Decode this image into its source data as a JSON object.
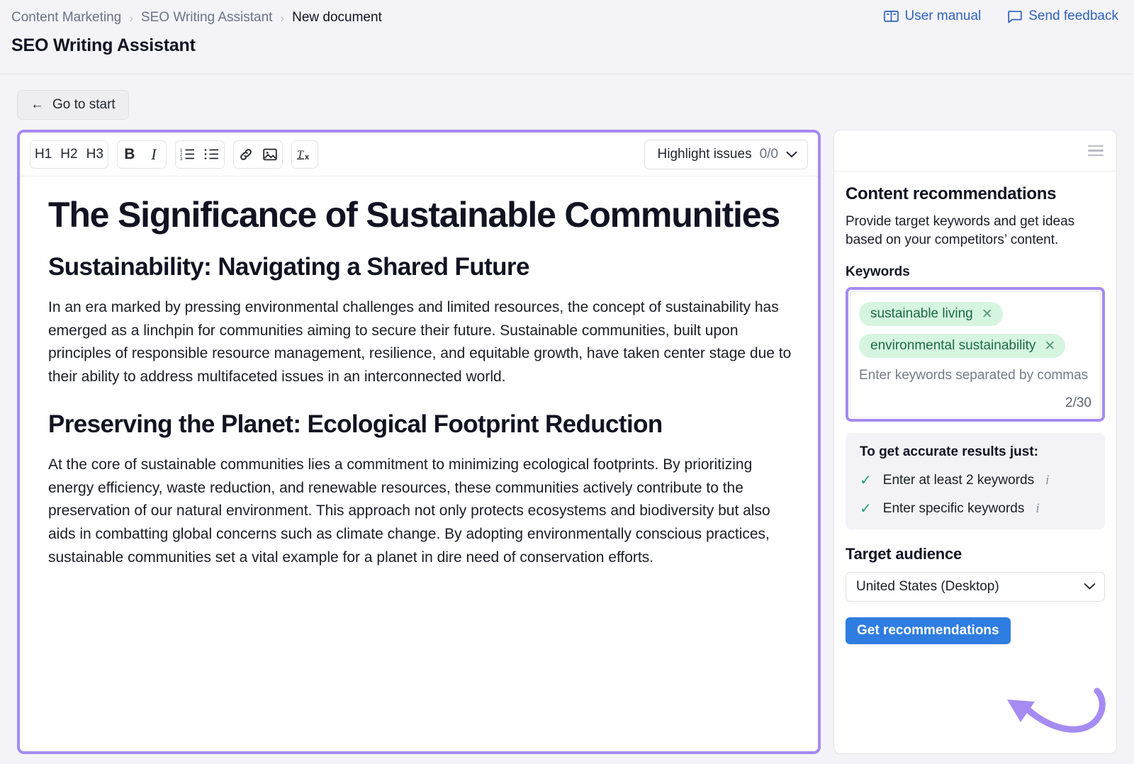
{
  "header": {
    "breadcrumb": [
      {
        "label": "Content Marketing",
        "current": false
      },
      {
        "label": "SEO Writing Assistant",
        "current": false
      },
      {
        "label": "New document",
        "current": true
      }
    ],
    "separator": "›",
    "title": "SEO Writing Assistant",
    "links": [
      {
        "label": "User manual",
        "icon": "book-icon"
      },
      {
        "label": "Send feedback",
        "icon": "chat-bubble-icon"
      }
    ],
    "link_color": "#2f62b8"
  },
  "subbar": {
    "go_to_start_label": "Go to start",
    "back_arrow": "←"
  },
  "editor": {
    "toolbar": {
      "heading1": "H1",
      "heading2": "H2",
      "heading3": "H3",
      "bold": "B",
      "italic": "I",
      "ordered_list": "ordered-list-icon",
      "bullet_list": "bullet-list-icon",
      "link": "link-icon",
      "image": "image-icon",
      "clear_format": "Tx"
    },
    "highlight_issues": {
      "label": "Highlight issues",
      "count": "0/0",
      "chevron": "⌄"
    },
    "document": {
      "h1": "The Significance of Sustainable Communities",
      "blocks": [
        {
          "type": "h2",
          "text": "Sustainability: Navigating a Shared Future"
        },
        {
          "type": "p",
          "text": "In an era marked by pressing environmental challenges and limited resources, the concept of sustainability has emerged as a linchpin for communities aiming to secure their future. Sustainable communities, built upon principles of responsible resource management, resilience, and equitable growth, have taken center stage due to their ability to address multifaceted issues in an interconnected world."
        },
        {
          "type": "h2",
          "text": "Preserving the Planet: Ecological Footprint Reduction"
        },
        {
          "type": "p",
          "text": "At the core of sustainable communities lies a commitment to minimizing ecological footprints. By prioritizing energy efficiency, waste reduction, and renewable resources, these communities actively contribute to the preservation of our natural environment. This approach not only protects ecosystems and biodiversity but also aids in combatting global concerns such as climate change. By adopting environmentally conscious practices, sustainable communities set a vital example for a planet in dire need of conservation efforts."
        }
      ]
    },
    "highlight_ring_color": "#a58bf2"
  },
  "sidebar": {
    "menu_icon": "hamburger-menu-icon",
    "title": "Content recommendations",
    "description": "Provide target keywords and get ideas based on your competitors’ content.",
    "keywords_label": "Keywords",
    "keywords": [
      {
        "text": "sustainable living",
        "remove": "✕"
      },
      {
        "text": "environmental sustainability",
        "remove": "✕"
      }
    ],
    "keywords_placeholder": "Enter keywords separated by commas",
    "keywords_count": "2/30",
    "chip_bg": "#d6f5e0",
    "chip_color": "#1c6b45",
    "tips": {
      "title": "To get accurate results just:",
      "items": [
        {
          "check": "✓",
          "text": "Enter at least 2 keywords",
          "info": "i"
        },
        {
          "check": "✓",
          "text": "Enter specific keywords",
          "info": "i"
        }
      ],
      "check_color": "#22a06b"
    },
    "audience": {
      "title": "Target audience",
      "selected": "United States (Desktop)",
      "chevron": "⌄"
    },
    "primary_button": {
      "label": "Get recommendations",
      "color": "#2f7de1"
    },
    "annotation_arrow_color": "#a58bf2"
  }
}
